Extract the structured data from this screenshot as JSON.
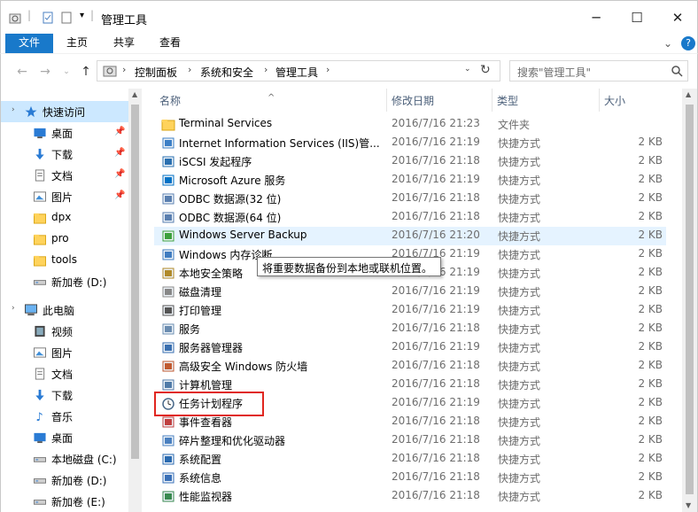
{
  "window": {
    "title": "管理工具",
    "colors": {
      "accent": "#1979ca",
      "selected": "#cce8ff",
      "hover": "#e5f3ff",
      "highlight": "#e0261f"
    }
  },
  "ribbon": {
    "tabs": [
      "文件",
      "主页",
      "共享",
      "查看"
    ]
  },
  "address": {
    "crumbs": [
      "控制面板",
      "系统和安全",
      "管理工具"
    ],
    "search_placeholder": "搜索\"管理工具\""
  },
  "nav": {
    "items": [
      {
        "label": "快速访问",
        "icon": "star-icon",
        "selected": true
      },
      {
        "label": "桌面",
        "icon": "desktop-icon",
        "pinned": true
      },
      {
        "label": "下载",
        "icon": "download-icon",
        "pinned": true
      },
      {
        "label": "文档",
        "icon": "document-icon",
        "pinned": true
      },
      {
        "label": "图片",
        "icon": "picture-icon",
        "pinned": true
      },
      {
        "label": "dpx",
        "icon": "folder-icon"
      },
      {
        "label": "pro",
        "icon": "folder-icon"
      },
      {
        "label": "tools",
        "icon": "folder-icon"
      },
      {
        "label": "新加卷 (D:)",
        "icon": "drive-icon"
      },
      {
        "label": "此电脑",
        "icon": "computer-icon"
      },
      {
        "label": "视频",
        "icon": "video-icon"
      },
      {
        "label": "图片",
        "icon": "picture-icon"
      },
      {
        "label": "文档",
        "icon": "document-icon"
      },
      {
        "label": "下载",
        "icon": "download-icon"
      },
      {
        "label": "音乐",
        "icon": "music-icon"
      },
      {
        "label": "桌面",
        "icon": "desktop-icon"
      },
      {
        "label": "本地磁盘 (C:)",
        "icon": "drive-icon"
      },
      {
        "label": "新加卷 (D:)",
        "icon": "drive-icon"
      },
      {
        "label": "新加卷 (E:)",
        "icon": "drive-icon"
      }
    ]
  },
  "columns": {
    "name": "名称",
    "date": "修改日期",
    "type": "类型",
    "size": "大小"
  },
  "files": [
    {
      "name": "Terminal Services",
      "date": "2016/7/16 21:23",
      "type": "文件夹",
      "size": "",
      "icon": "folder-icon"
    },
    {
      "name": "Internet Information Services (IIS)管...",
      "date": "2016/7/16 21:19",
      "type": "快捷方式",
      "size": "2 KB",
      "icon": "iis-icon"
    },
    {
      "name": "iSCSI 发起程序",
      "date": "2016/7/16 21:18",
      "type": "快捷方式",
      "size": "2 KB",
      "icon": "iscsi-icon"
    },
    {
      "name": "Microsoft Azure 服务",
      "date": "2016/7/16 21:19",
      "type": "快捷方式",
      "size": "2 KB",
      "icon": "azure-icon"
    },
    {
      "name": "ODBC 数据源(32 位)",
      "date": "2016/7/16 21:18",
      "type": "快捷方式",
      "size": "2 KB",
      "icon": "odbc-icon"
    },
    {
      "name": "ODBC 数据源(64 位)",
      "date": "2016/7/16 21:18",
      "type": "快捷方式",
      "size": "2 KB",
      "icon": "odbc-icon"
    },
    {
      "name": "Windows Server Backup",
      "date": "2016/7/16 21:20",
      "type": "快捷方式",
      "size": "2 KB",
      "icon": "backup-icon"
    },
    {
      "name": "Windows 内存诊断",
      "date": "2016/7/16 21:19",
      "type": "快捷方式",
      "size": "2 KB",
      "icon": "memory-icon"
    },
    {
      "name": "本地安全策略",
      "date": "2016/7/16 21:19",
      "type": "快捷方式",
      "size": "2 KB",
      "icon": "security-policy-icon"
    },
    {
      "name": "磁盘清理",
      "date": "2016/7/16 21:19",
      "type": "快捷方式",
      "size": "2 KB",
      "icon": "disk-cleanup-icon"
    },
    {
      "name": "打印管理",
      "date": "2016/7/16 21:19",
      "type": "快捷方式",
      "size": "2 KB",
      "icon": "printer-icon"
    },
    {
      "name": "服务",
      "date": "2016/7/16 21:18",
      "type": "快捷方式",
      "size": "2 KB",
      "icon": "services-icon"
    },
    {
      "name": "服务器管理器",
      "date": "2016/7/16 21:19",
      "type": "快捷方式",
      "size": "2 KB",
      "icon": "server-manager-icon"
    },
    {
      "name": "高级安全 Windows 防火墙",
      "date": "2016/7/16 21:18",
      "type": "快捷方式",
      "size": "2 KB",
      "icon": "firewall-icon"
    },
    {
      "name": "计算机管理",
      "date": "2016/7/16 21:18",
      "type": "快捷方式",
      "size": "2 KB",
      "icon": "computer-management-icon"
    },
    {
      "name": "任务计划程序",
      "date": "2016/7/16 21:19",
      "type": "快捷方式",
      "size": "2 KB",
      "icon": "task-scheduler-icon"
    },
    {
      "name": "事件查看器",
      "date": "2016/7/16 21:18",
      "type": "快捷方式",
      "size": "2 KB",
      "icon": "event-viewer-icon"
    },
    {
      "name": "碎片整理和优化驱动器",
      "date": "2016/7/16 21:18",
      "type": "快捷方式",
      "size": "2 KB",
      "icon": "defrag-icon"
    },
    {
      "name": "系统配置",
      "date": "2016/7/16 21:18",
      "type": "快捷方式",
      "size": "2 KB",
      "icon": "system-config-icon"
    },
    {
      "name": "系统信息",
      "date": "2016/7/16 21:18",
      "type": "快捷方式",
      "size": "2 KB",
      "icon": "system-info-icon"
    },
    {
      "name": "性能监视器",
      "date": "2016/7/16 21:18",
      "type": "快捷方式",
      "size": "2 KB",
      "icon": "performance-monitor-icon"
    }
  ],
  "tooltip": "将重要数据备份到本地或联机位置。"
}
